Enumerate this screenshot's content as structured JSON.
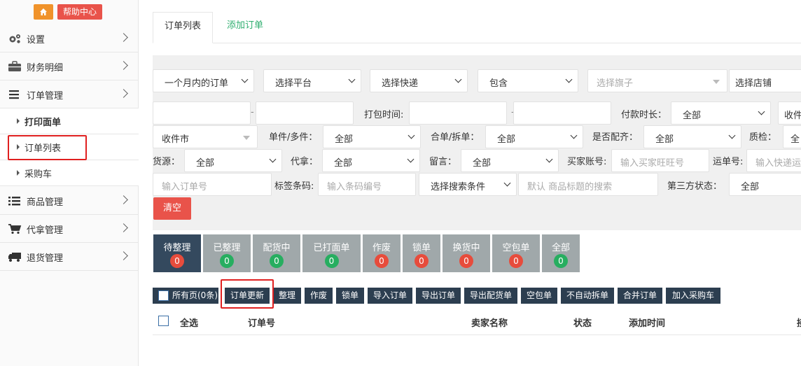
{
  "sidebar": {
    "home_icon": "home-icon",
    "help_label": "帮助中心",
    "menu": [
      {
        "label": "设置",
        "icon": "gears-icon"
      },
      {
        "label": "财务明细",
        "icon": "briefcase-icon"
      },
      {
        "label": "订单管理",
        "icon": "list-lines-icon"
      },
      {
        "label": "商品管理",
        "icon": "list-bullets-icon"
      },
      {
        "label": "代拿管理",
        "icon": "cart-icon"
      },
      {
        "label": "退货管理",
        "icon": "truck-icon"
      }
    ],
    "sub": [
      {
        "label": "打印面单",
        "bold": true
      },
      {
        "label": "订单列表",
        "highlighted": true
      },
      {
        "label": "采购车"
      }
    ]
  },
  "tabs": [
    {
      "label": "订单列表",
      "active": true
    },
    {
      "label": "添加订单",
      "active": false
    }
  ],
  "filters": {
    "period": "一个月内的订单",
    "platform": "选择平台",
    "express": "选择快递",
    "contains": "包含",
    "flag_placeholder": "选择旗子",
    "shop": "选择店铺",
    "pack_time_label": "打包时间:",
    "pay_duration_label": "付款时长：",
    "pay_duration_value": "全部",
    "receiver_cut": "收件",
    "receiver_city": "收件市",
    "single_multi_label": "单件/多件：",
    "single_multi_value": "全部",
    "merge_split_label": "合单/拆单：",
    "merge_split_value": "全部",
    "match_label": "是否配齐：",
    "match_value": "全部",
    "qc_label": "质检：",
    "qc_value_cut": "全",
    "source_label": "货源：",
    "source_value": "全部",
    "proxy_label": "代拿：",
    "proxy_value": "全部",
    "message_label": "留言：",
    "message_value": "全部",
    "buyer_label": "买家账号:",
    "buyer_placeholder": "输入买家旺旺号",
    "waybill_label": "运单号:",
    "waybill_placeholder": "输入快递运",
    "order_placeholder": "输入订单号",
    "barcode_label": "标签条码:",
    "barcode_placeholder": "输入条码编号",
    "search_condition": "选择搜索条件",
    "title_placeholder": "默认 商品标题的搜索",
    "third_status_label": "第三方状态：",
    "third_status_value": "全部",
    "clear_label": "清空",
    "dash": "-"
  },
  "status_tabs": [
    {
      "label": "待整理",
      "count": "0",
      "color": "red",
      "active": true
    },
    {
      "label": "已整理",
      "count": "0",
      "color": "green"
    },
    {
      "label": "配货中",
      "count": "0",
      "color": "green"
    },
    {
      "label": "已打面单",
      "count": "0",
      "color": "green"
    },
    {
      "label": "作废",
      "count": "0",
      "color": "red"
    },
    {
      "label": "锁单",
      "count": "0",
      "color": "red"
    },
    {
      "label": "换货中",
      "count": "0",
      "color": "red"
    },
    {
      "label": "空包单",
      "count": "0",
      "color": "red"
    },
    {
      "label": "全部",
      "count": "0",
      "color": "green"
    }
  ],
  "actions": {
    "all_pages": "所有页(0条)",
    "buttons": [
      "订单更新",
      "整理",
      "作废",
      "锁单",
      "导入订单",
      "导出订单",
      "导出配货单",
      "空包单",
      "不自动拆单",
      "合并订单",
      "加入采购车"
    ]
  },
  "table": {
    "headers": [
      "全选",
      "订单号",
      "卖家名称",
      "状态",
      "添加时间",
      "接"
    ]
  }
}
